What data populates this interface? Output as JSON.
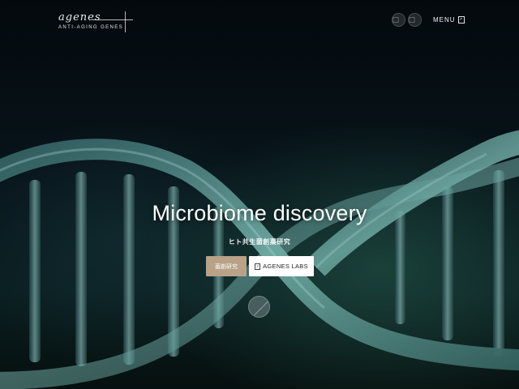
{
  "header": {
    "logo_text": "agenes",
    "logo_tagline": "ANTI-AGING GENES",
    "lang_buttons": [
      "⃞",
      "⃞"
    ],
    "menu_label": "MENU",
    "menu_icon": "external-link-icon"
  },
  "hero": {
    "title": "Microbiome discovery",
    "subtitle": "ヒト共生菌創薬研究",
    "primary_button": "菌創研究",
    "secondary_button": "AGENES LABS",
    "secondary_icon": "external-link-icon",
    "scroll_icon": "scroll-down-indicator-icon"
  },
  "colors": {
    "background": "#061016",
    "primary_button": "#b9a287",
    "secondary_button": "#ffffff",
    "dna_highlight": "#4f8f8b"
  }
}
